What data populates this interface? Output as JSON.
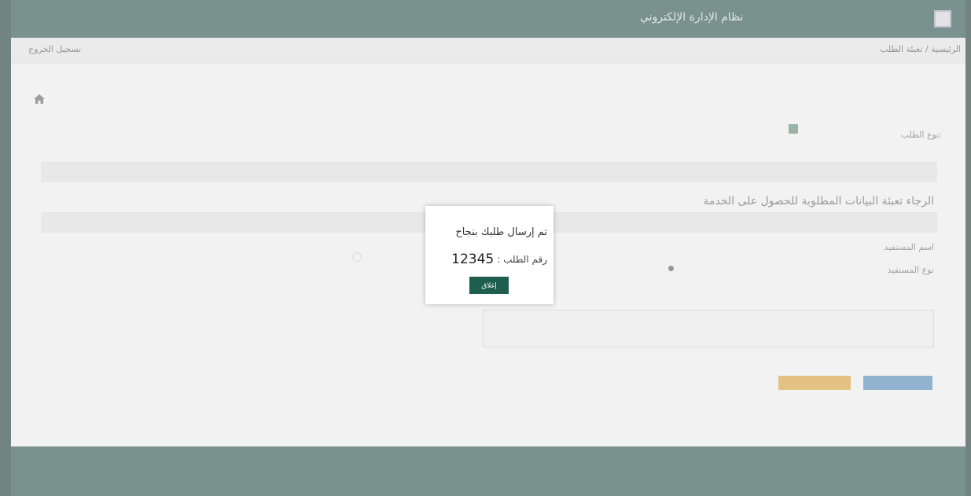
{
  "topbar": {
    "brand_text": "",
    "title": "نظام الإدارة الإلكتروني"
  },
  "breadcrumb": "الرئيسية / تعبئة الطلب",
  "logout": "تسجيل الخروج",
  "form": {
    "requester_type_label": "نوع الطلب:",
    "requester_type_option": "",
    "section_header": "",
    "note": "الرجاء تعبئة البيانات المطلوبة للحصول على الخدمة",
    "beneficiary_name_label": "اسم المستفيد",
    "beneficiary_type_label": "نوع المستفيد",
    "contract_label": "",
    "contract_option_1": "",
    "contract_option_2": "",
    "notes_label": "",
    "notes_value": "",
    "fee_text": "",
    "submit_label": "",
    "cancel_label": ""
  },
  "modal": {
    "title": "تم إرسال طلبك بنجاح",
    "request_label": "رقم الطلب :",
    "request_number": "12345",
    "ok_label": "إغلاق"
  },
  "colors": {
    "header": "#3c5f57",
    "modal_button": "#1e5e4e",
    "submit": "#5f8fba",
    "cancel": "#d7a54a"
  }
}
